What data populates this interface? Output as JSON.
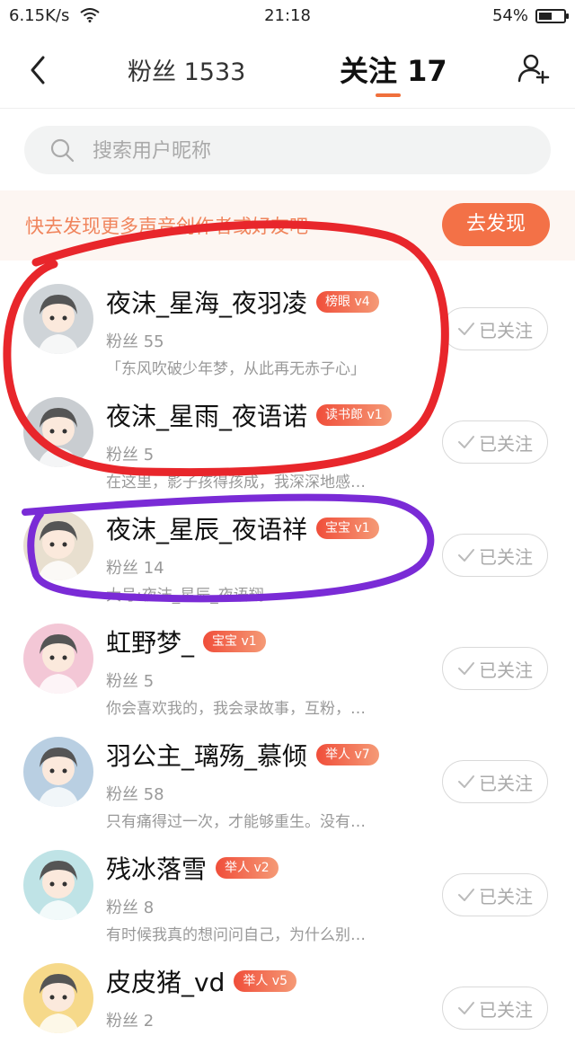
{
  "status": {
    "speed": "6.15K/s",
    "time": "21:18",
    "battery": "54%",
    "battery_level": 0.54
  },
  "nav": {
    "fans_tab": "粉丝 1533",
    "follow_tab": "关注 17"
  },
  "search": {
    "placeholder": "搜索用户昵称"
  },
  "discover": {
    "text": "快去发现更多声音创作者或好友吧~",
    "button": "去发现"
  },
  "follow_label": "已关注",
  "users": [
    {
      "name": "夜沫_星海_夜羽凌",
      "badge": "榜眼 v4",
      "fans": "粉丝 55",
      "bio": "「东风吹破少年梦，从此再无赤子心」",
      "avatar_color": "#cfd4d8"
    },
    {
      "name": "夜沫_星雨_夜语诺",
      "badge": "读书郎 v1",
      "fans": "粉丝 5",
      "bio": "在这里，影子孩得孩成，我深深地感…",
      "avatar_color": "#c9cdd1"
    },
    {
      "name": "夜沫_星辰_夜语祥",
      "badge": "宝宝 v1",
      "fans": "粉丝 14",
      "bio": "大号:夜沫_星辰_夜语翔",
      "avatar_color": "#e8dfcf"
    },
    {
      "name": "虹野梦_",
      "badge": "宝宝 v1",
      "fans": "粉丝 5",
      "bio": "你会喜欢我的，我会录故事，互粉，…",
      "avatar_color": "#f3c7d6"
    },
    {
      "name": "羽公主_璃殇_慕倾",
      "badge": "举人 v7",
      "fans": "粉丝 58",
      "bio": "只有痛得过一次，才能够重生。没有…",
      "avatar_color": "#b9cfe2"
    },
    {
      "name": "残冰落雪",
      "badge": "举人 v2",
      "fans": "粉丝 8",
      "bio": "有时候我真的想问问自己，为什么别…",
      "avatar_color": "#bfe3e6"
    },
    {
      "name": "皮皮猪_vd",
      "badge": "举人 v5",
      "fans": "粉丝 2",
      "bio": "",
      "avatar_color": "#f6d98a"
    }
  ],
  "colors": {
    "accent": "#f37147",
    "annotation_red": "#e8262b",
    "annotation_purple": "#7a2bd6"
  }
}
